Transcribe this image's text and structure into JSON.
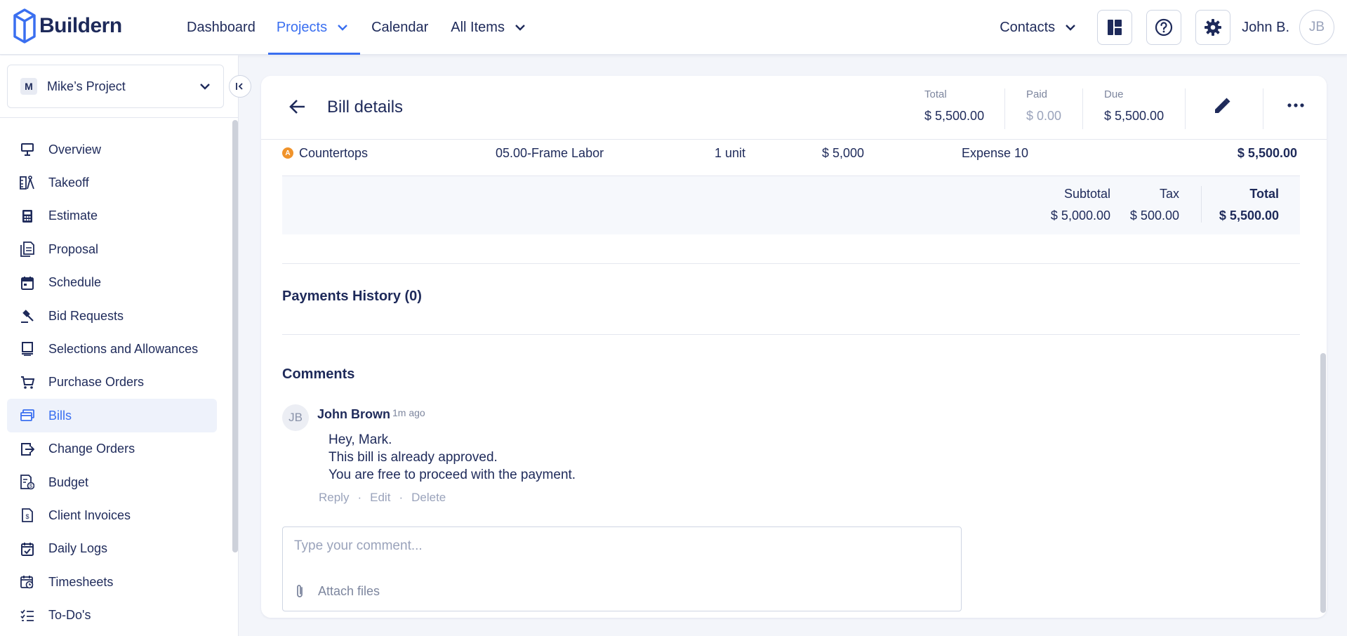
{
  "header": {
    "logo_text": "Buildern",
    "nav": [
      {
        "label": "Dashboard",
        "dropdown": false,
        "active": false
      },
      {
        "label": "Projects",
        "dropdown": true,
        "active": true
      },
      {
        "label": "Calendar",
        "dropdown": false,
        "active": false
      },
      {
        "label": "All Items",
        "dropdown": true,
        "active": false
      }
    ],
    "contacts_label": "Contacts",
    "user_name": "John B.",
    "user_initials": "JB",
    "accent_color": "#3a6ff0",
    "text_color": "#1e2a5a"
  },
  "sidebar": {
    "project_initial": "M",
    "project_name": "Mike’s Project",
    "items": [
      {
        "label": "Overview",
        "icon": "overview-icon"
      },
      {
        "label": "Takeoff",
        "icon": "takeoff-icon"
      },
      {
        "label": "Estimate",
        "icon": "calculator-icon"
      },
      {
        "label": "Proposal",
        "icon": "proposal-icon"
      },
      {
        "label": "Schedule",
        "icon": "calendar-icon"
      },
      {
        "label": "Bid Requests",
        "icon": "gavel-icon"
      },
      {
        "label": "Selections and Allowances",
        "icon": "selections-icon"
      },
      {
        "label": "Purchase Orders",
        "icon": "cart-icon"
      },
      {
        "label": "Bills",
        "icon": "bills-icon",
        "active": true
      },
      {
        "label": "Change Orders",
        "icon": "change-orders-icon"
      },
      {
        "label": "Budget",
        "icon": "budget-icon"
      },
      {
        "label": "Client Invoices",
        "icon": "invoice-icon"
      },
      {
        "label": "Daily Logs",
        "icon": "daily-log-icon"
      },
      {
        "label": "Timesheets",
        "icon": "timesheet-icon"
      },
      {
        "label": "To-Do's",
        "icon": "todo-icon"
      }
    ]
  },
  "bill": {
    "title": "Bill details",
    "total_label": "Total",
    "total_value": "$ 5,500.00",
    "paid_label": "Paid",
    "paid_value": "$ 0.00",
    "due_label": "Due",
    "due_value": "$ 5,500.00",
    "line_item": {
      "badge": "A",
      "name": "Countertops",
      "cost_code": "05.00-Frame Labor",
      "quantity": "1 unit",
      "unit_cost": "$ 5,000",
      "expense": "Expense 10",
      "amount": "$ 5,500.00"
    },
    "summary": {
      "subtotal_label": "Subtotal",
      "subtotal_value": "$ 5,000.00",
      "tax_label": "Tax",
      "tax_value": "$ 500.00",
      "total_label": "Total",
      "total_value": "$ 5,500.00"
    },
    "payments_history_title": "Payments History (0)",
    "comments_title": "Comments",
    "comment": {
      "initials": "JB",
      "author": "John Brown",
      "time": "1m ago",
      "lines": [
        "Hey, Mark.",
        "This bill is already approved.",
        "You are free to proceed with the payment."
      ],
      "actions": {
        "reply": "Reply",
        "edit": "Edit",
        "delete": "Delete"
      }
    },
    "comment_placeholder": "Type your comment...",
    "attach_label": "Attach files",
    "badge_color": "#f0932b"
  }
}
